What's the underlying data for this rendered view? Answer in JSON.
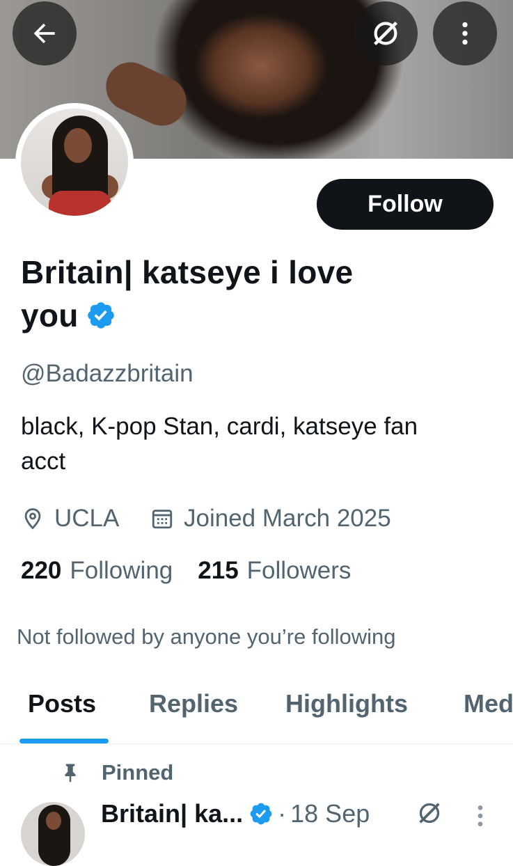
{
  "header": {
    "back_icon": "arrow-left-icon",
    "grok_icon": "grok-icon",
    "more_icon": "more-vertical-icon"
  },
  "profile": {
    "follow_label": "Follow",
    "name_line1": "Britain| katseye i love",
    "name_line2": "you",
    "handle": "@Badazzbritain",
    "bio_line1": "black, K-pop Stan, cardi, katseye fan",
    "bio_line2": "acct",
    "location": "UCLA",
    "joined": "Joined March 2025",
    "following_count": "220",
    "following_label": "Following",
    "followers_count": "215",
    "followers_label": "Followers",
    "not_followed": "Not followed by anyone you’re following"
  },
  "tabs": [
    {
      "label": "Posts",
      "active": true
    },
    {
      "label": "Replies",
      "active": false
    },
    {
      "label": "Highlights",
      "active": false
    },
    {
      "label": "Med",
      "active": false
    }
  ],
  "post": {
    "pinned_label": "Pinned",
    "author": "Britain| ka...",
    "separator": "·",
    "date": "18 Sep"
  },
  "colors": {
    "accent": "#1d9bf0",
    "text_primary": "#0f1419",
    "text_secondary": "#536471",
    "follow_bg": "#0f1419"
  }
}
